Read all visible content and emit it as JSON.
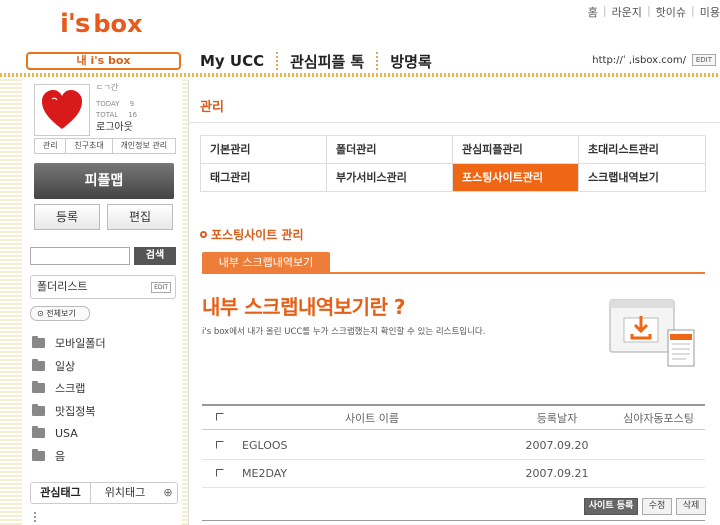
{
  "header": {
    "logo_i": "i's",
    "logo_box": "box",
    "top_links": [
      "홈",
      "라운지",
      "핫이슈",
      "미용"
    ],
    "my_isbox_label": "내 i's box",
    "nav": [
      "My UCC",
      "관심피플 톡",
      "방명록"
    ],
    "url": "http://ˈ    ,isbox.com/",
    "edit_label": "EDIT"
  },
  "profile": {
    "name": "ㄷㄱ간",
    "today_label": "TODAY",
    "today_count": "9",
    "total_label": "TOTAL",
    "total_count": "16",
    "logout": "로그아웃",
    "tabs": [
      "관리",
      "친구초대",
      "개인정보 관리"
    ]
  },
  "sidebar": {
    "people_map": "피플맵",
    "register": "등록",
    "edit": "편집",
    "search_btn": "검색",
    "folder_list_title": "폴더리스트",
    "folder_edit": "EDIT",
    "view_all": "전체보기",
    "folders": [
      "모바일폴더",
      "일상",
      "스크랩",
      "맛집정복",
      "USA",
      "음"
    ],
    "tag_tab1": "관심태그",
    "tag_tab2": "위치태그",
    "plus": "⊕"
  },
  "main": {
    "title": "관리",
    "menu": [
      "기본관리",
      "폴더관리",
      "관심피플관리",
      "초대리스트관리",
      "태그관리",
      "부가서비스관리",
      "포스팅사이트관리",
      "스크랩내역보기"
    ],
    "active_menu": "포스팅사이트관리",
    "section_title": "포스팅사이트 관리",
    "tab_label": "내부 스크랩내역보기",
    "heading": "내부 스크랩내역보기란 ?",
    "description": "i's box에서 내가 올린 UCC를 누가 스크랩했는지 확인할 수 있는 리스트입니다.",
    "table": {
      "headers": [
        "사이트 이름",
        "등록날자",
        "심야자동포스팅"
      ],
      "rows": [
        {
          "name": "EGLOOS",
          "date": "2007.09.20"
        },
        {
          "name": "ME2DAY",
          "date": "2007.09.21"
        }
      ]
    },
    "buttons": {
      "register": "사이트 등록",
      "edit": "수정",
      "delete": "삭제"
    }
  },
  "colors": {
    "accent": "#ef6614",
    "title": "#d85c1a"
  }
}
